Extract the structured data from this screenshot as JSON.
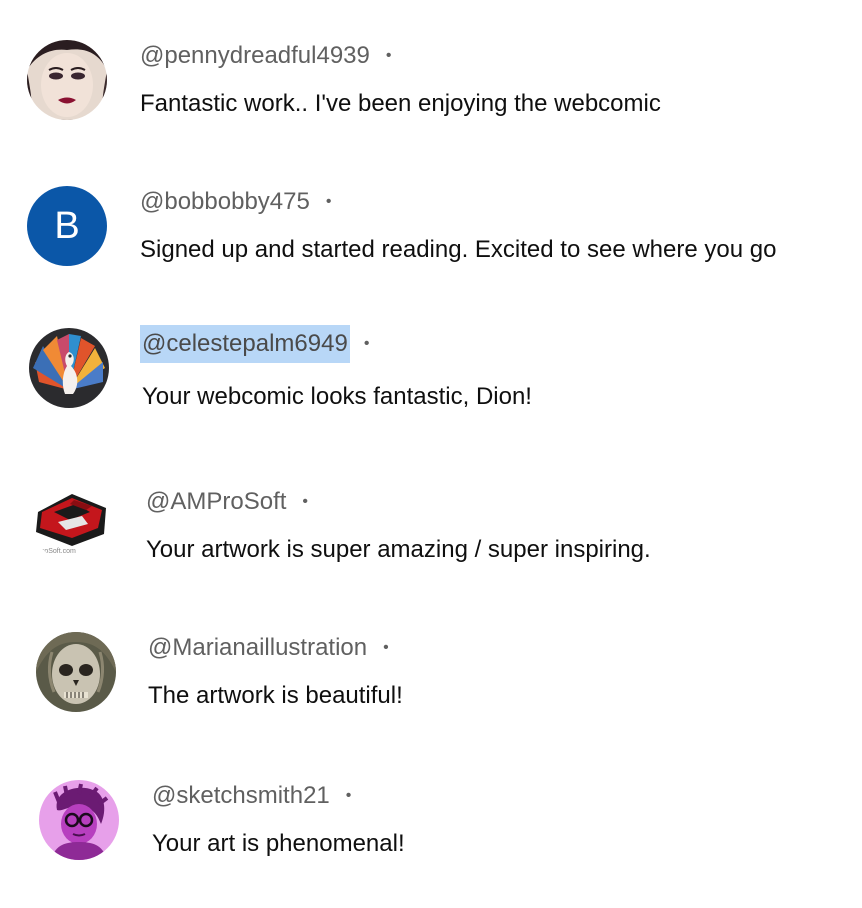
{
  "comments": [
    {
      "author": "@pennydreadful4939",
      "separator": "•",
      "text": "Fantastic work.. I've been enjoying the webcomic",
      "avatar_icon": "portrait-woman-red-lips-icon"
    },
    {
      "author": "@bobbobby475",
      "separator": "•",
      "text": "Signed up and started reading. Excited to see where you go",
      "avatar_letter": "B",
      "avatar_color": "#0b57a8"
    },
    {
      "author": "@celestepalm6949",
      "separator": "•",
      "text": "Your webcomic looks fantastic, Dion!",
      "avatar_icon": "peacock-icon",
      "selected": true
    },
    {
      "author": "@AMProSoft",
      "separator": "•",
      "text": "Your artwork is super amazing / super inspiring.",
      "avatar_icon": "amprosoft-logo-icon",
      "avatar_caption": "roSoft.com"
    },
    {
      "author": "@Marianaillustration",
      "separator": "•",
      "text": "The artwork is beautiful!",
      "avatar_icon": "skull-portrait-icon"
    },
    {
      "author": "@sketchsmith21",
      "separator": "•",
      "text": "Your art is phenomenal!",
      "avatar_icon": "purple-person-glasses-icon",
      "avatar_color": "#e7a0ea"
    }
  ]
}
